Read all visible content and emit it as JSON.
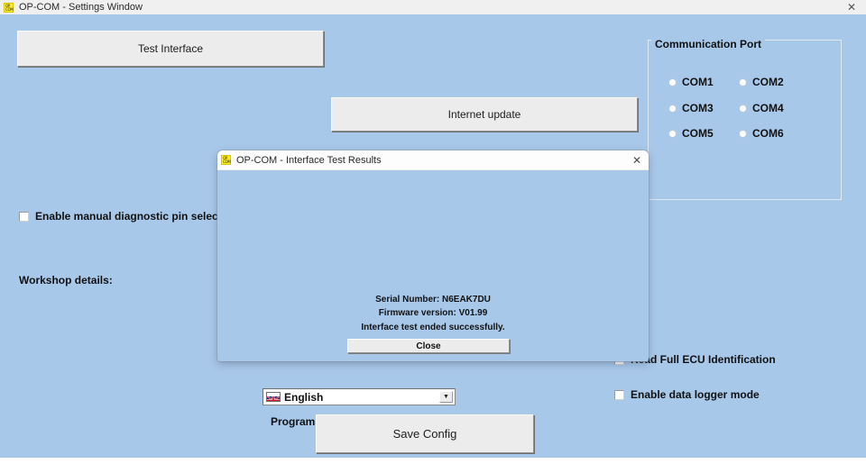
{
  "window": {
    "title": "OP-COM - Settings Window",
    "icon": "opcom-app-icon",
    "close_label": "✕",
    "background_color": "#a8c8ea"
  },
  "main": {
    "test_interface_button": "Test Interface",
    "internet_update_button": "Internet update",
    "save_config_button": "Save Config",
    "program_label": "Program",
    "workshop_label": "Workshop details:",
    "checkboxes": [
      {
        "label": "Enable manual diagnostic pin selection",
        "checked": false
      },
      {
        "label": "Read Full ECU Identification",
        "checked": false
      },
      {
        "label": "Enable data logger mode",
        "checked": false
      }
    ],
    "language": {
      "selected": "English",
      "flag": "uk-flag-icon",
      "arrow": "▼"
    }
  },
  "comm_port": {
    "legend": "Communication Port",
    "options": [
      {
        "label": "COM1",
        "selected": false
      },
      {
        "label": "COM2",
        "selected": false
      },
      {
        "label": "COM3",
        "selected": false
      },
      {
        "label": "COM4",
        "selected": false
      },
      {
        "label": "COM5",
        "selected": false
      },
      {
        "label": "COM6",
        "selected": false
      }
    ]
  },
  "dialog": {
    "title": "OP-COM - Interface Test Results",
    "icon": "opcom-app-icon",
    "close_label": "✕",
    "serial_number": "Serial Number: N6EAK7DU",
    "firmware_version": "Firmware version: V01.99",
    "status_message": "Interface test ended successfully.",
    "close_button": "Close"
  }
}
